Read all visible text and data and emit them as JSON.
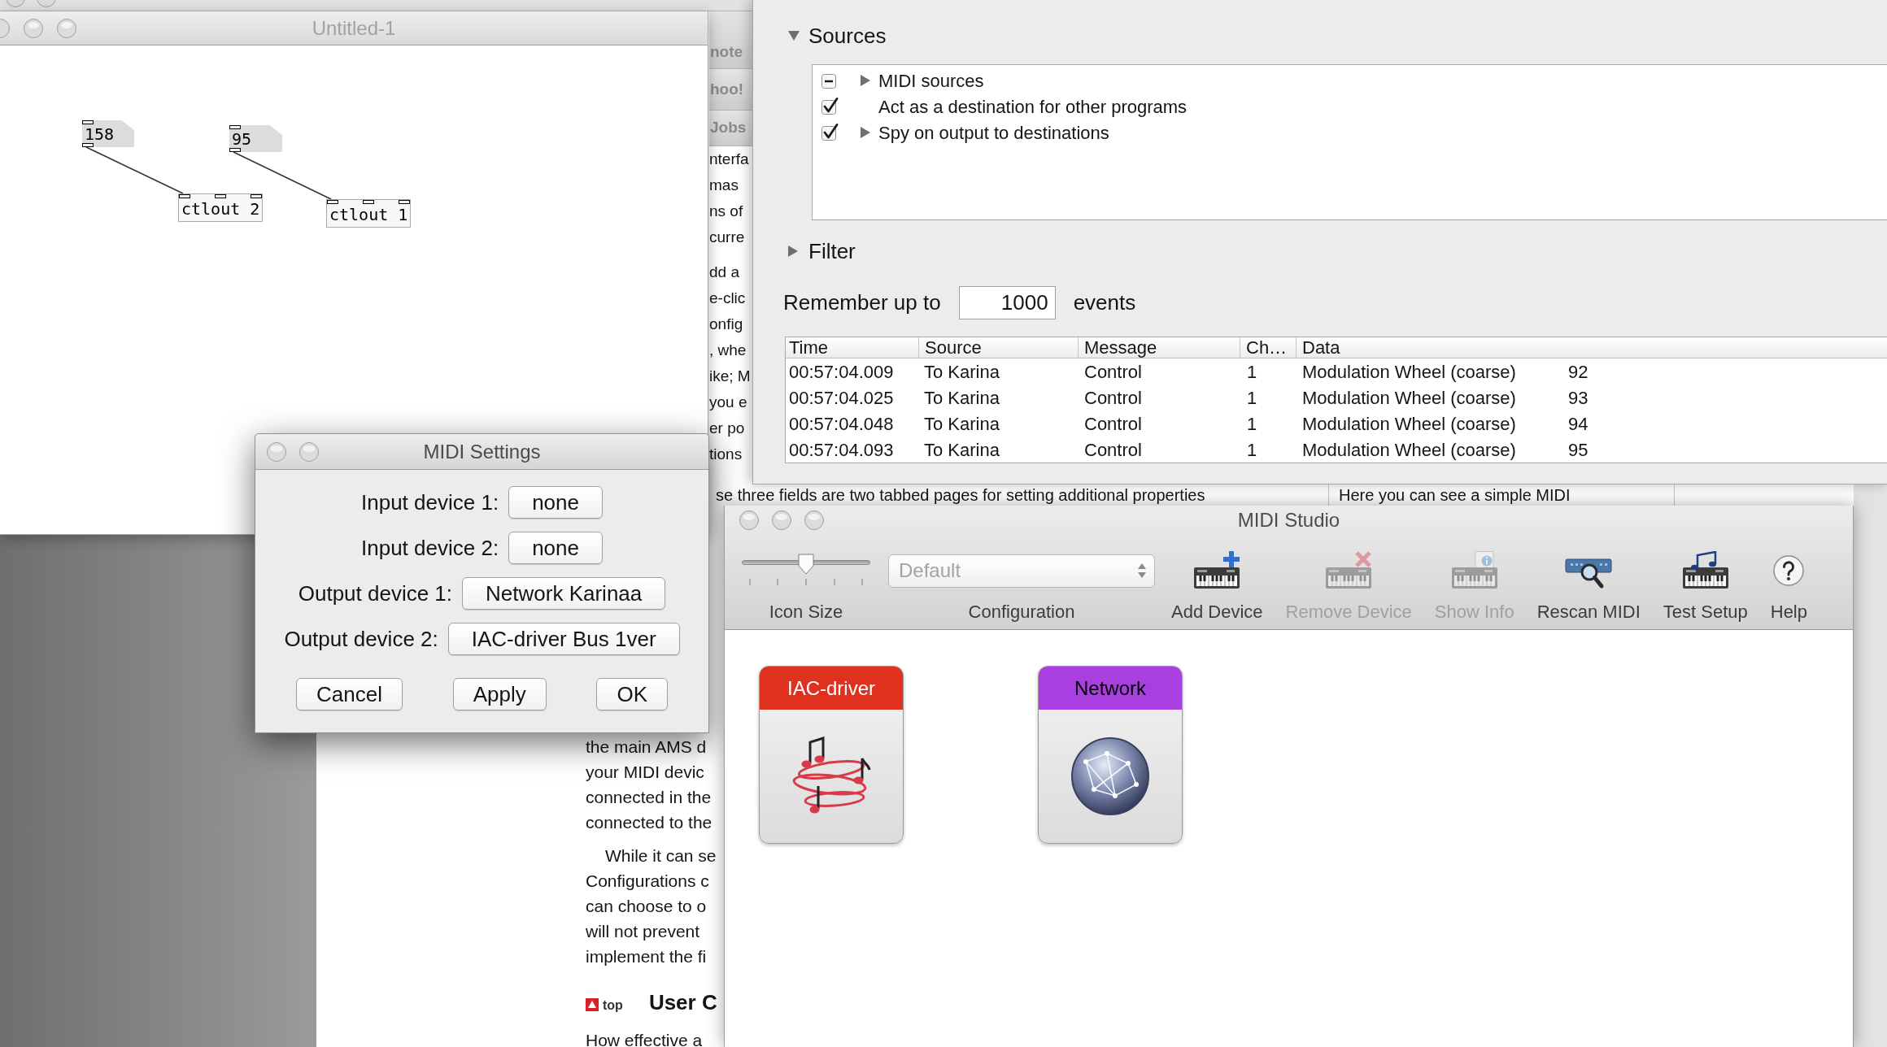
{
  "document_page": {
    "tabs": [
      {
        "label": "note"
      },
      {
        "label": "hoo!"
      },
      {
        "label": "Jobs"
      }
    ],
    "column_paragraphs": [
      [
        "nterfa",
        "mas",
        "ns of",
        "curre"
      ],
      [
        "dd a",
        "e-clic",
        "onfig",
        ", whe",
        "ike; M",
        "you e",
        "er po",
        "tions"
      ]
    ],
    "cut_line": [
      "se three fields are two tabbed pages for setting additional properties",
      "Here you can see a simple MIDI"
    ],
    "paragraphs": [
      {
        "indented": false,
        "lines": [
          "the main AMS d",
          "your MIDI devic",
          "connected in the",
          "connected to the"
        ]
      },
      {
        "indented": true,
        "lines": [
          "While it can se",
          "Configurations c",
          "can choose to o",
          "will not prevent",
          "implement the fi"
        ]
      }
    ],
    "top_link": "top",
    "heading": "User C",
    "last_line": "How effective a"
  },
  "patch_window": {
    "title": "Untitled-1",
    "boxes": [
      {
        "kind": "number",
        "text": "158"
      },
      {
        "kind": "number",
        "text": "95"
      },
      {
        "kind": "object",
        "text": "ctlout 2"
      },
      {
        "kind": "object",
        "text": "ctlout 1"
      }
    ]
  },
  "monitor_window": {
    "sources": {
      "label": "Sources",
      "expanded": true,
      "items": [
        {
          "label": "MIDI sources",
          "checked": false,
          "mixed": true,
          "expandable": true,
          "expanded": false
        },
        {
          "label": "Act as a destination for other programs",
          "checked": true,
          "mixed": false,
          "expandable": false,
          "expanded": false
        },
        {
          "label": "Spy on output to destinations",
          "checked": true,
          "mixed": false,
          "expandable": true,
          "expanded": false
        }
      ]
    },
    "filter": {
      "label": "Filter",
      "expanded": false
    },
    "remember": {
      "label": "Remember up to",
      "value": "1000",
      "unit": "events"
    },
    "table": {
      "columns": [
        "Time",
        "Source",
        "Message",
        "Ch…",
        "Data"
      ],
      "rows": [
        {
          "time": "00:57:04.009",
          "source": "To Karina",
          "message": "Control",
          "channel": "1",
          "data": "Modulation Wheel (coarse)",
          "value": "92"
        },
        {
          "time": "00:57:04.025",
          "source": "To Karina",
          "message": "Control",
          "channel": "1",
          "data": "Modulation Wheel (coarse)",
          "value": "93"
        },
        {
          "time": "00:57:04.048",
          "source": "To Karina",
          "message": "Control",
          "channel": "1",
          "data": "Modulation Wheel (coarse)",
          "value": "94"
        },
        {
          "time": "00:57:04.093",
          "source": "To Karina",
          "message": "Control",
          "channel": "1",
          "data": "Modulation Wheel (coarse)",
          "value": "95"
        }
      ]
    }
  },
  "settings_dialog": {
    "title": "MIDI Settings",
    "fields": [
      {
        "label": "Input device 1:",
        "value": "none"
      },
      {
        "label": "Input device 2:",
        "value": "none"
      },
      {
        "label": "Output device 1:",
        "value": "Network Karinaa"
      },
      {
        "label": "Output device 2:",
        "value": "IAC-driver Bus 1ver"
      }
    ],
    "buttons": [
      "Cancel",
      "Apply",
      "OK"
    ]
  },
  "studio_window": {
    "title": "MIDI Studio",
    "icon_size": {
      "label": "Icon Size",
      "level": 0.5
    },
    "configuration": {
      "label": "Configuration",
      "value": "Default",
      "disabled": true
    },
    "tools": [
      {
        "kind": "add",
        "label": "Add Device",
        "disabled": false
      },
      {
        "kind": "remove",
        "label": "Remove Device",
        "disabled": true
      },
      {
        "kind": "info",
        "label": "Show Info",
        "disabled": true
      },
      {
        "kind": "rescan",
        "label": "Rescan MIDI",
        "disabled": false
      },
      {
        "kind": "test",
        "label": "Test Setup",
        "disabled": false
      },
      {
        "kind": "help",
        "label": "Help",
        "disabled": false
      }
    ],
    "devices": [
      {
        "kind": "iac",
        "name": "IAC-driver",
        "color": "#e0301e"
      },
      {
        "kind": "network",
        "name": "Network",
        "color": "#a93fe0"
      }
    ]
  }
}
